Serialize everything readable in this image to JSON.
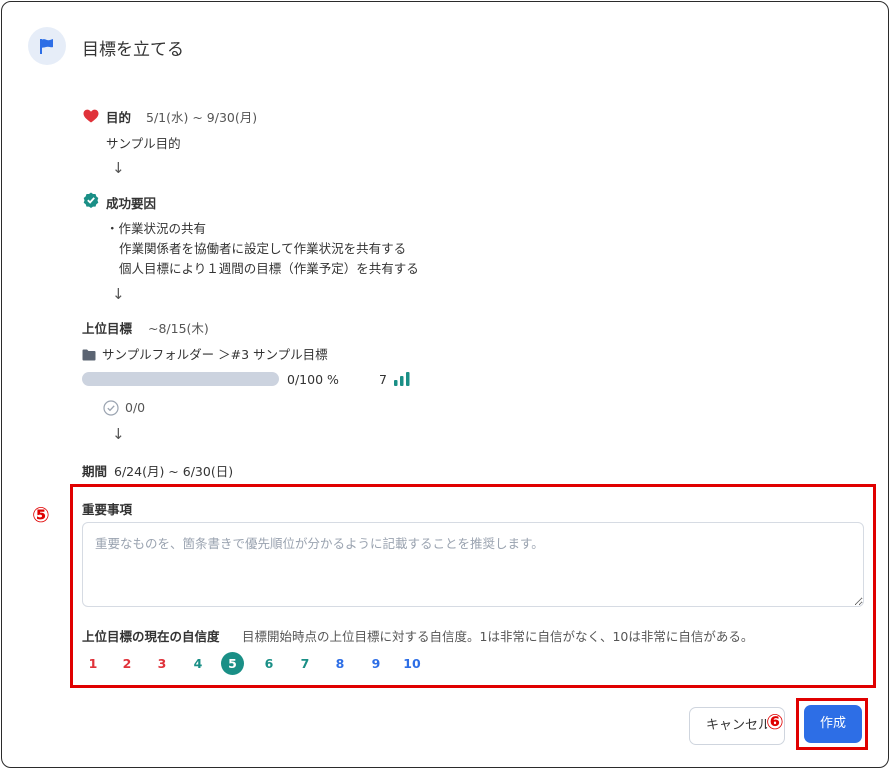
{
  "dialog": {
    "title": "目標を立てる"
  },
  "purpose": {
    "label": "目的",
    "period": "5/1(水) ~ 9/30(月)",
    "text": "サンプル目的"
  },
  "success": {
    "label": "成功要因",
    "line1": "・作業状況の共有",
    "line2": "作業関係者を協働者に設定して作業状況を共有する",
    "line3": "個人目標により１週間の目標（作業予定）を共有する"
  },
  "parent": {
    "label": "上位目標",
    "due": "~8/15(木)",
    "path": "サンプルフォルダー ＞#3 サンプル目標",
    "progress_text": "0/100 %",
    "progress_fraction": 0,
    "level": "7",
    "checks": "0/0"
  },
  "period": {
    "label": "期間",
    "value": "6/24(月) ~ 6/30(日)"
  },
  "important": {
    "label": "重要事項",
    "placeholder": "重要なものを、箇条書きで優先順位が分かるように記載することを推奨します。",
    "value": ""
  },
  "confidence": {
    "label": "上位目標の現在の自信度",
    "hint": "目標開始時点の上位目標に対する自信度。1は非常に自信がなく、10は非常に自信がある。",
    "selected": "5",
    "scores": [
      "1",
      "2",
      "3",
      "4",
      "5",
      "6",
      "7",
      "8",
      "9",
      "10"
    ]
  },
  "buttons": {
    "cancel": "キャンセル",
    "create": "作成"
  },
  "annotations": {
    "five": "⑤",
    "six": "⑥"
  },
  "colors": {
    "low": "#e0323a",
    "mid": "#1a8f86",
    "high": "#2d6ee6",
    "accent": "#2d6ee6",
    "highlight": "#e00000"
  },
  "icons": {
    "header": "flag-icon",
    "purpose": "heart-icon",
    "success": "check-badge-icon",
    "folder": "folder-icon",
    "level": "signal-bars-icon",
    "checks": "check-circle-icon"
  }
}
